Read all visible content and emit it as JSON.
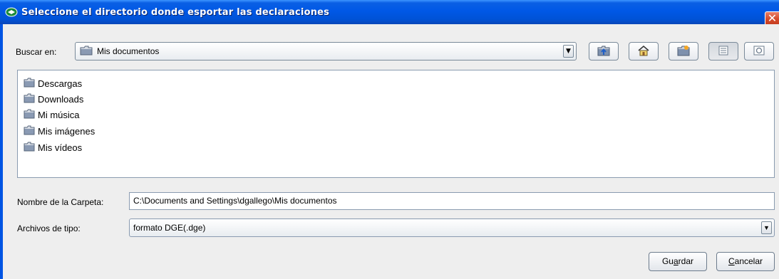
{
  "window": {
    "title": "Seleccione el directorio donde esportar las declaraciones",
    "close_glyph": "✕"
  },
  "lookin": {
    "label": "Buscar en:",
    "value": "Mis documentos",
    "arrow": "▼"
  },
  "toolbar": {
    "buttons": [
      {
        "name": "up-folder-icon"
      },
      {
        "name": "home-icon"
      },
      {
        "name": "new-folder-icon"
      },
      {
        "name": "list-view-icon",
        "pressed": true
      },
      {
        "name": "details-view-icon"
      }
    ]
  },
  "files": [
    {
      "label": "Descargas"
    },
    {
      "label": "Downloads"
    },
    {
      "label": "Mi música"
    },
    {
      "label": "Mis imágenes"
    },
    {
      "label": "Mis vídeos"
    }
  ],
  "folder_name": {
    "label": "Nombre de la Carpeta:",
    "value": "C:\\Documents and Settings\\dgallego\\Mis documentos"
  },
  "file_type": {
    "label": "Archivos de tipo:",
    "value": "formato DGE(.dge)",
    "arrow": "▼"
  },
  "actions": {
    "save_prefix": "Gu",
    "save_mnemonic": "a",
    "save_suffix": "rdar",
    "cancel_mnemonic": "C",
    "cancel_suffix": "ancelar"
  },
  "colors": {
    "titlebar": "#0054e3",
    "folder": "#6b7fa0",
    "close": "#d44a2a"
  }
}
